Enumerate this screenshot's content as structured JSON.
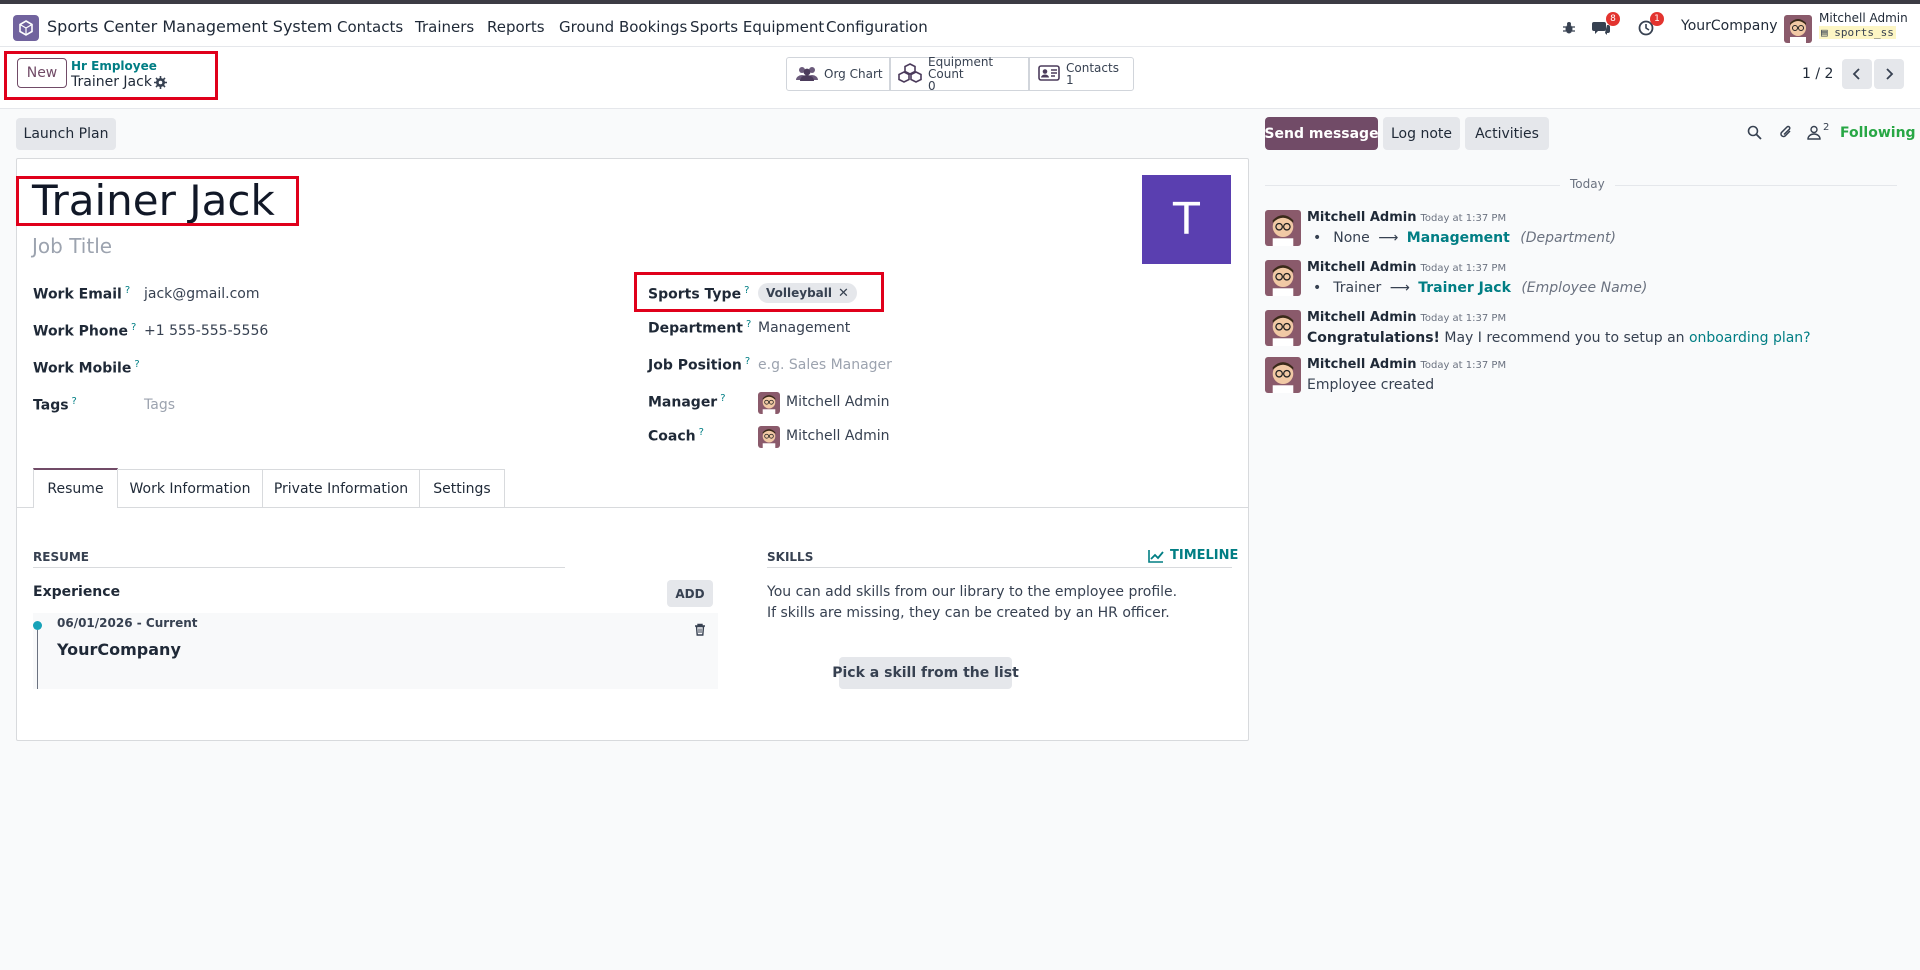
{
  "navbar": {
    "app_name": "Sports Center Management System",
    "menus": [
      "Contacts",
      "Trainers",
      "Reports",
      "Ground Bookings",
      "Sports Equipment",
      "Configuration"
    ],
    "messages_badge": "8",
    "activities_badge": "1",
    "company": "YourCompany",
    "user_name": "Mitchell Admin",
    "db_name": "sports_ss"
  },
  "control": {
    "new_label": "New",
    "breadcrumb_parent": "Hr Employee",
    "breadcrumb_current": "Trainer Jack",
    "smart_buttons": {
      "org_chart": "Org Chart",
      "equipment_count_label": "Equipment Count",
      "equipment_count_value": "0",
      "contacts_label": "Contacts",
      "contacts_value": "1"
    },
    "pager": "1 / 2"
  },
  "form": {
    "launch_plan": "Launch Plan",
    "employee_name": "Trainer Jack",
    "job_title_placeholder": "Job Title",
    "avatar_letter": "T",
    "left_fields": {
      "work_email_label": "Work Email",
      "work_email": "jack@gmail.com",
      "work_phone_label": "Work Phone",
      "work_phone": "+1 555-555-5556",
      "work_mobile_label": "Work Mobile",
      "tags_label": "Tags",
      "tags_placeholder": "Tags"
    },
    "right_fields": {
      "sports_type_label": "Sports Type",
      "sports_type_tag": "Volleyball",
      "department_label": "Department",
      "department": "Management",
      "job_position_label": "Job Position",
      "job_position_placeholder": "e.g. Sales Manager",
      "manager_label": "Manager",
      "manager": "Mitchell Admin",
      "coach_label": "Coach",
      "coach": "Mitchell Admin"
    },
    "tabs": [
      "Resume",
      "Work Information",
      "Private Information",
      "Settings"
    ],
    "resume": {
      "section_title": "RESUME",
      "experience_label": "Experience",
      "add_label": "ADD",
      "entry_date": "06/01/2026 - Current",
      "entry_company": "YourCompany"
    },
    "skills": {
      "section_title": "SKILLS",
      "timeline_label": "TIMELINE",
      "help_line1": "You can add skills from our library to the employee profile.",
      "help_line2": "If skills are missing, they can be created by an HR officer.",
      "pick_button": "Pick a skill from the list"
    }
  },
  "chatter": {
    "send_message": "Send message",
    "log_note": "Log note",
    "activities": "Activities",
    "followers_count": "2",
    "following": "Following",
    "date_separator": "Today",
    "messages": [
      {
        "author": "Mitchell Admin",
        "time": "Today at 1:37 PM",
        "old": "None",
        "new": "Management",
        "field": "(Department)"
      },
      {
        "author": "Mitchell Admin",
        "time": "Today at 1:37 PM",
        "old": "Trainer",
        "new": "Trainer Jack",
        "field": "(Employee Name)"
      },
      {
        "author": "Mitchell Admin",
        "time": "Today at 1:37 PM",
        "bold": "Congratulations!",
        "text": " May I recommend you to setup an ",
        "link": "onboarding plan?"
      },
      {
        "author": "Mitchell Admin",
        "time": "Today at 1:37 PM",
        "text": "Employee created"
      }
    ]
  },
  "colors": {
    "brand": "#714b67",
    "teal": "#017e84",
    "avatar_bg": "#5a3fb0",
    "annotation_red": "#e0001b"
  }
}
